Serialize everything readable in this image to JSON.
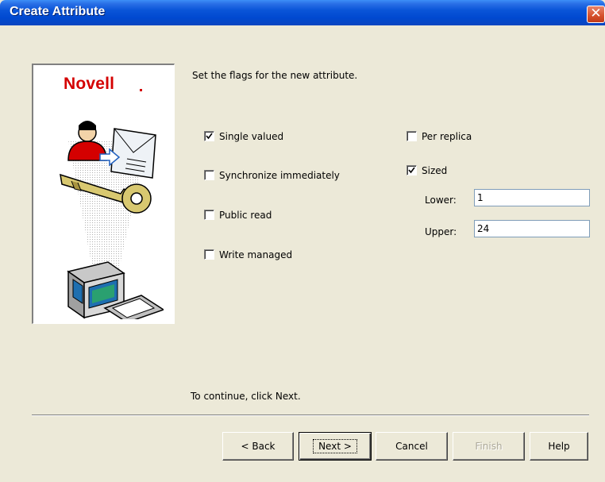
{
  "window": {
    "title": "Create Attribute",
    "close_symbol": "✕"
  },
  "branding": {
    "logo_text": "Novell"
  },
  "instructions": {
    "heading": "Set the flags for the new attribute.",
    "footer": "To continue, click Next."
  },
  "flags": {
    "single_valued": {
      "label": "Single valued",
      "checked": true
    },
    "synchronize_immediately": {
      "label": "Synchronize immediately",
      "checked": false
    },
    "public_read": {
      "label": "Public read",
      "checked": false
    },
    "write_managed": {
      "label": "Write managed",
      "checked": false
    },
    "per_replica": {
      "label": "Per replica",
      "checked": false
    },
    "sized": {
      "label": "Sized",
      "checked": true
    }
  },
  "size": {
    "lower_label": "Lower:",
    "lower_value": "1",
    "upper_label": "Upper:",
    "upper_value": "24"
  },
  "buttons": {
    "back": "< Back",
    "next": "Next >",
    "cancel": "Cancel",
    "finish": "Finish",
    "help": "Help"
  },
  "colors": {
    "titlebar": "#0a55d8",
    "dialog_bg": "#ece9d8",
    "logo_red": "#d40000",
    "disabled_text": "#aca899"
  }
}
